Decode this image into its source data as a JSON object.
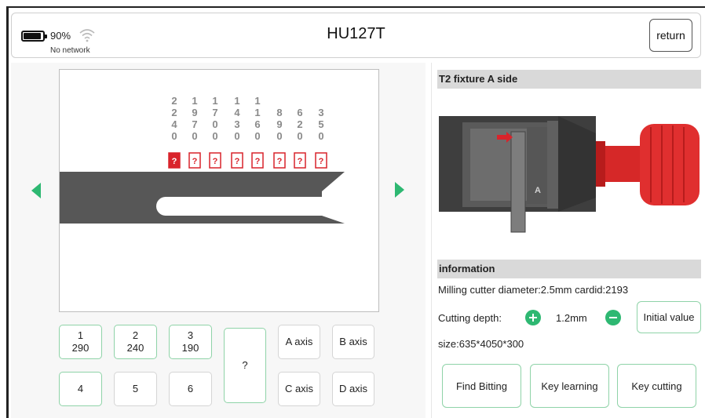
{
  "status": {
    "battery": "90%",
    "battery_level": 0.9,
    "network": "No network",
    "wifi_icon": "wifi-icon"
  },
  "header": {
    "title": "HU127T",
    "return_label": "return"
  },
  "cuts": {
    "depths": [
      [
        "2",
        "2",
        "4",
        "0"
      ],
      [
        "1",
        "9",
        "7",
        "0"
      ],
      [
        "1",
        "7",
        "0",
        "0"
      ],
      [
        "1",
        "4",
        "3",
        "0"
      ],
      [
        "1",
        "1",
        "6",
        "0"
      ],
      [
        "8",
        "9",
        "0"
      ],
      [
        "6",
        "2",
        "0"
      ],
      [
        "3",
        "5",
        "0"
      ]
    ],
    "markers": [
      "?",
      "?",
      "?",
      "?",
      "?",
      "?",
      "?",
      "?"
    ],
    "selected_index": 0
  },
  "keypad": {
    "k1": {
      "num": "1",
      "val": "290"
    },
    "k2": {
      "num": "2",
      "val": "240"
    },
    "k3": {
      "num": "3",
      "val": "190"
    },
    "k4": {
      "num": "4"
    },
    "k5": {
      "num": "5"
    },
    "k6": {
      "num": "6"
    },
    "unknown": "?",
    "a_axis": "A axis",
    "b_axis": "B axis",
    "c_axis": "C axis",
    "d_axis": "D axis"
  },
  "right": {
    "fixture_title": "T2 fixture A side",
    "fixture_label": "A",
    "info_title": "information",
    "cutter_line": "Milling cutter diameter:2.5mm  cardid:2193",
    "cutting_depth_label": "Cutting depth:",
    "cutting_depth_value": "1.2mm",
    "initial_value": "Initial value",
    "size_line": "size:635*4050*300",
    "find_bitting": "Find Bitting",
    "key_learning": "Key learning",
    "key_cutting": "Key cutting"
  },
  "colors": {
    "accent": "#2eb872",
    "marker": "#d9232b",
    "key_body": "#575757"
  }
}
